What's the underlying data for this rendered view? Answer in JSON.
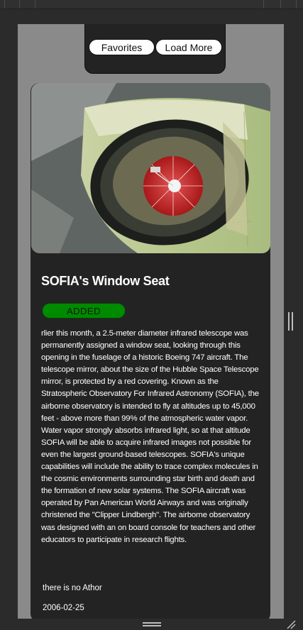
{
  "nav": {
    "favorites_label": "Favorites",
    "load_more_label": "Load More"
  },
  "card": {
    "image_description": "Infrared telescope inside aircraft fuselage opening",
    "title": "SOFIA's Window Seat",
    "status_badge": "ADDED",
    "description": "rlier this month, a 2.5-meter diameter infrared telescope was permanently assigned a window seat, looking through this opening in the fuselage of a historic Boeing 747 aircraft. The telescope mirror, about the size of the Hubble Space Telescope mirror, is protected by a red covering. Known as the Stratospheric Observatory For Infrared Astronomy (SOFIA), the airborne observatory is intended to fly at altitudes up to 45,000 feet - above more than 99% of the atmospheric water vapor. Water vapor strongly absorbs infrared light, so at that altitude SOFIA will be able to acquire infrared images not possible for even the largest ground-based telescopes. SOFIA's unique capabilities will include the ability to trace complex molecules in the cosmic environments surrounding star birth and death and the formation of new solar systems. The SOFIA aircraft was operated by Pan American World Airways and was originally christened the \"Clipper Lindbergh\". The airborne observatory was designed with an on board console for teachers and other educators to participate in research flights.",
    "author": "there is no Athor",
    "date": "2006-02-25"
  },
  "colors": {
    "badge_green": "#008a00",
    "card_bg": "#232323",
    "page_bg": "#8a8a8a"
  }
}
